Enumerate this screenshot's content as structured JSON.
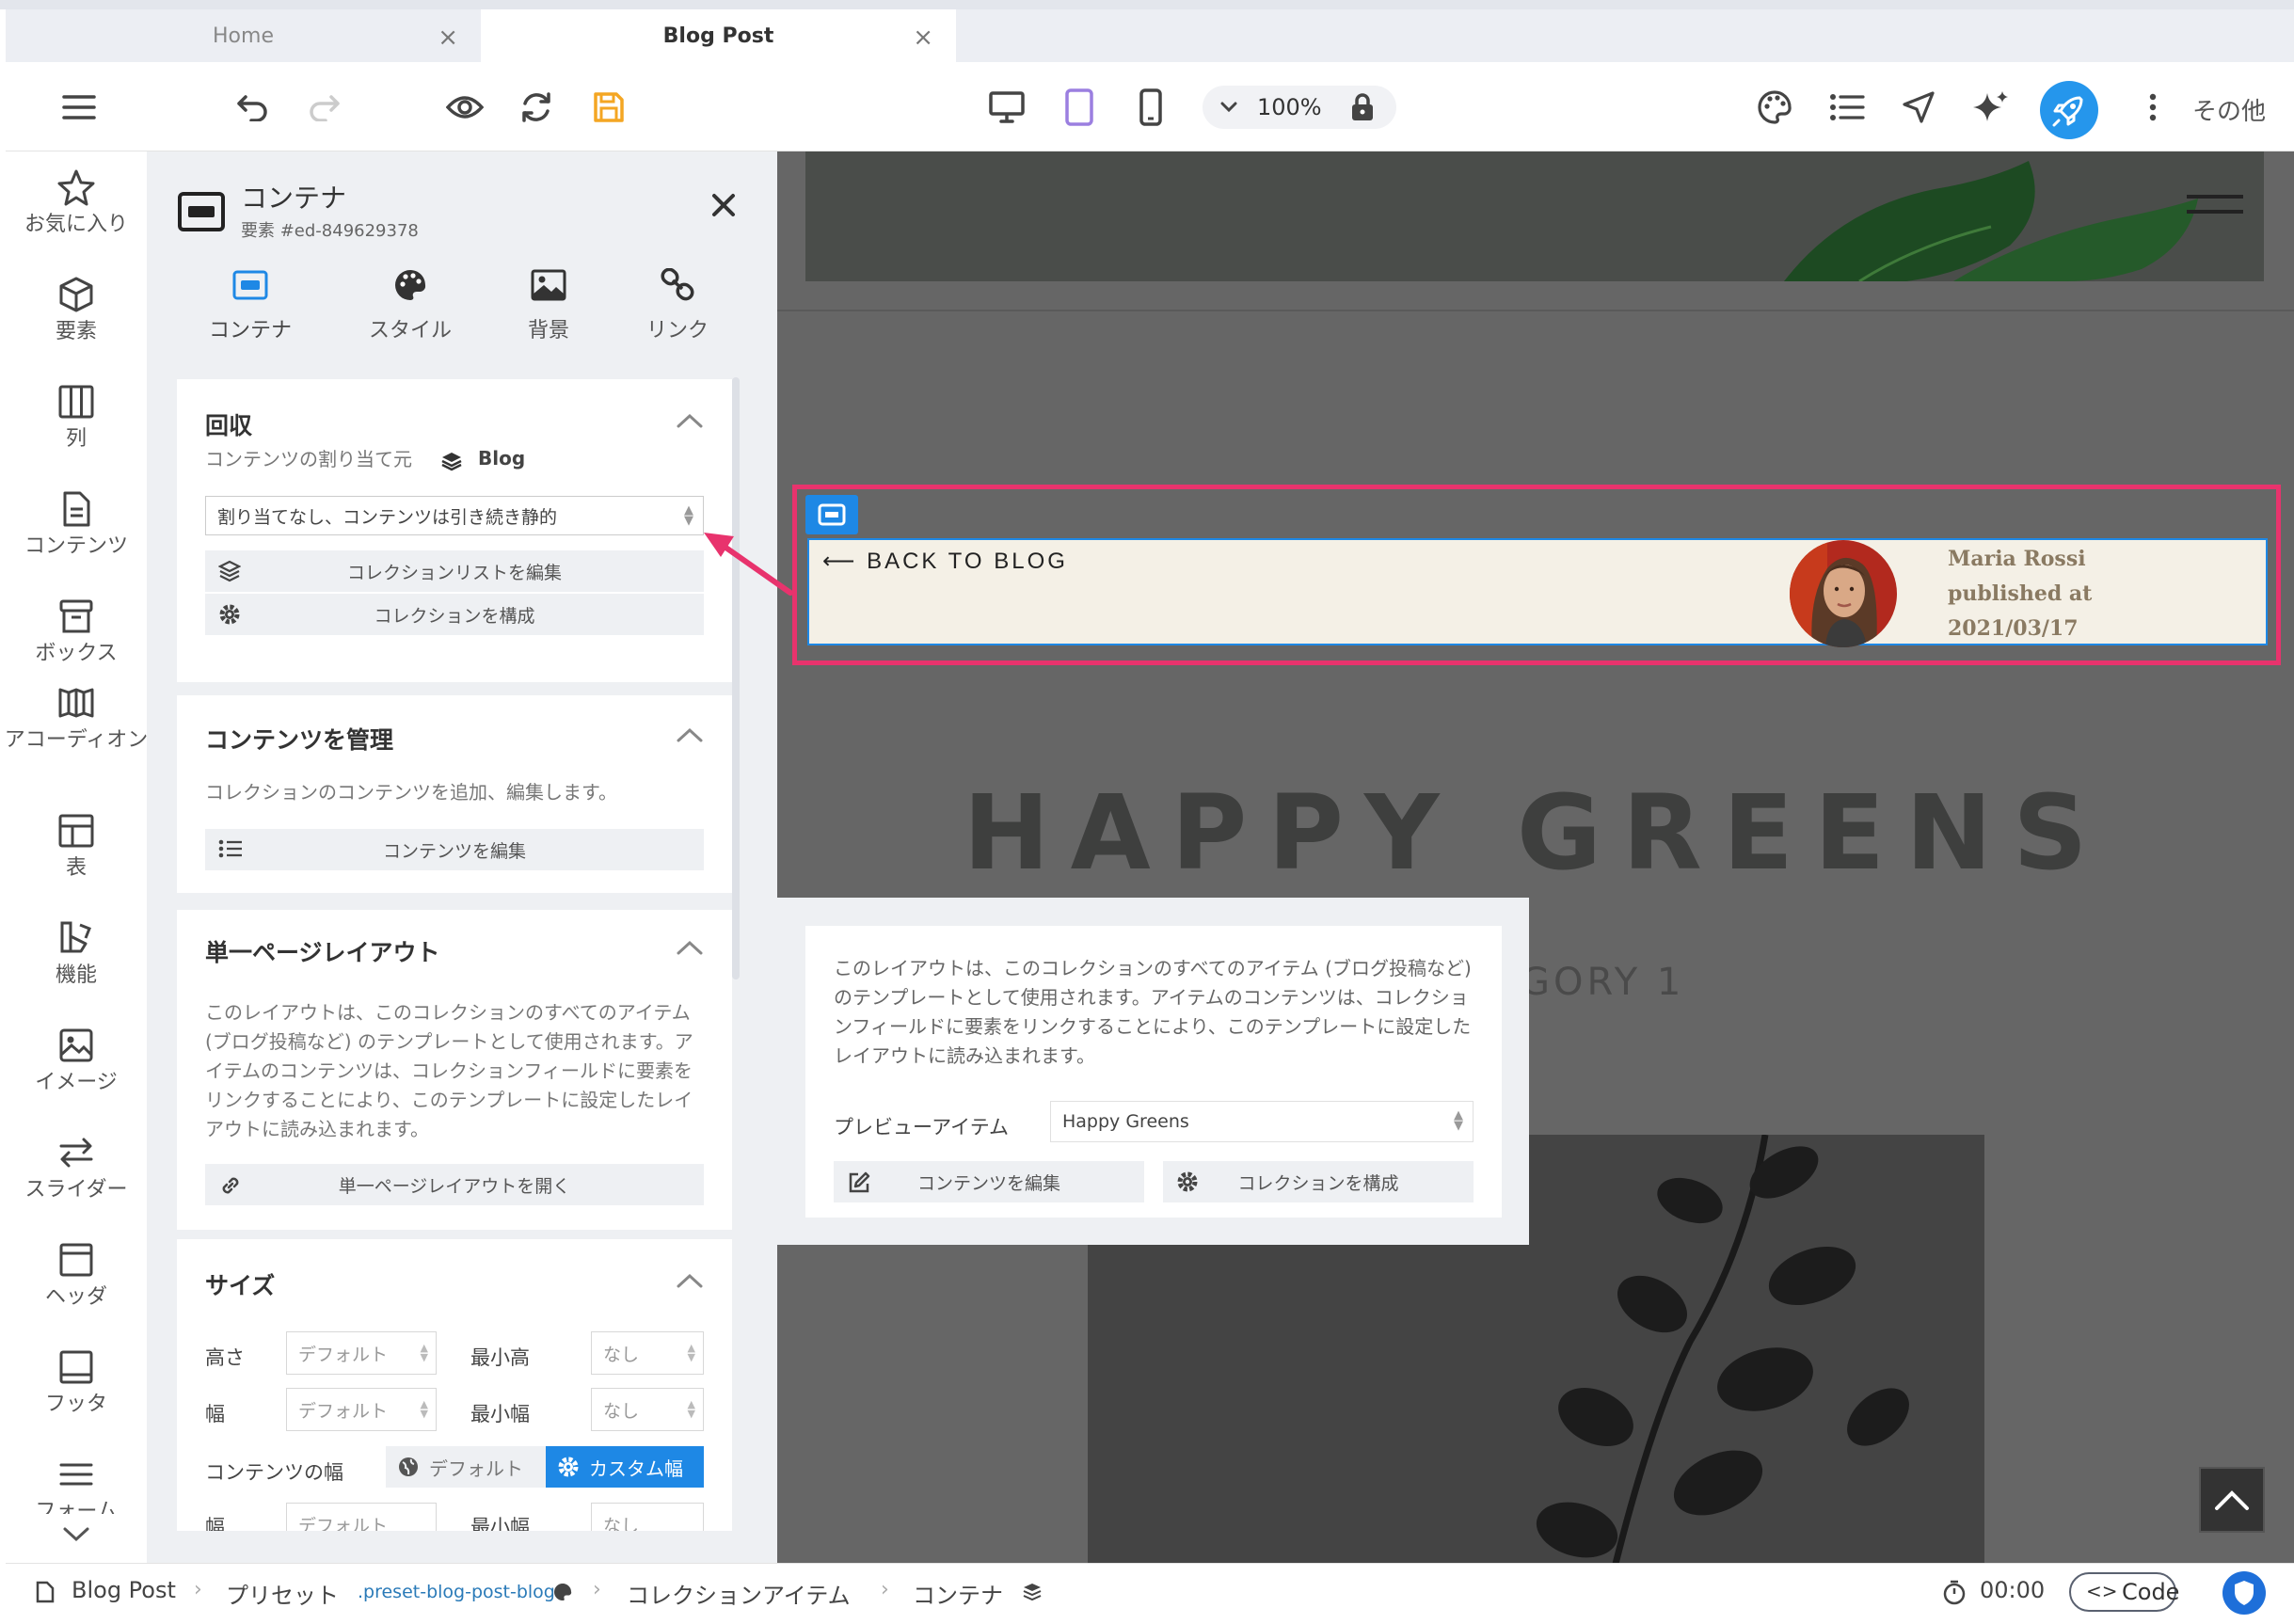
{
  "tabs": [
    {
      "label": "Home"
    },
    {
      "label": "Blog Post"
    }
  ],
  "toolbar": {
    "zoom": "100%",
    "more_label": "その他"
  },
  "rail": [
    {
      "label": "お気に入り"
    },
    {
      "label": "要素"
    },
    {
      "label": "列"
    },
    {
      "label": "コンテンツ"
    },
    {
      "label": "ボックス"
    },
    {
      "label": "アコーディオン"
    },
    {
      "label": "表"
    },
    {
      "label": "機能"
    },
    {
      "label": "イメージ"
    },
    {
      "label": "スライダー"
    },
    {
      "label": "ヘッダ"
    },
    {
      "label": "フッタ"
    },
    {
      "label": "フォーム"
    }
  ],
  "panel": {
    "title": "コンテナ",
    "subtitle": "要素 #ed-849629378",
    "tabs": [
      {
        "label": "コンテナ"
      },
      {
        "label": "スタイル"
      },
      {
        "label": "背景"
      },
      {
        "label": "リンク"
      }
    ],
    "collection": {
      "heading": "回収",
      "assign_label": "コンテンツの割り当て元",
      "assign_source": "Blog",
      "select_value": "割り当てなし、コンテンツは引き続き静的",
      "edit_list_btn": "コレクションリストを編集",
      "configure_btn": "コレクションを構成"
    },
    "manage": {
      "heading": "コンテンツを管理",
      "desc": "コレクションのコンテンツを追加、編集します。",
      "edit_btn": "コンテンツを編集"
    },
    "single": {
      "heading": "単一ページレイアウト",
      "desc": "このレイアウトは、このコレクションのすべてのアイテム (ブログ投稿など) のテンプレートとして使用されます。アイテムのコンテンツは、コレクションフィールドに要素をリンクすることにより、このテンプレートに設定したレイアウトに読み込まれます。",
      "open_btn": "単一ページレイアウトを開く"
    },
    "size": {
      "heading": "サイズ",
      "height_label": "高さ",
      "height_value": "デフォルト",
      "min_height_label": "最小高",
      "min_height_value": "なし",
      "width_label": "幅",
      "width_value": "デフォルト",
      "min_width_label": "最小幅",
      "min_width_value": "なし",
      "content_width_label": "コンテンツの幅",
      "default_opt": "デフォルト",
      "custom_opt": "カスタム幅",
      "width2_label": "幅",
      "width2_value": "デフォルト",
      "max_width_label": "最小幅",
      "max_width_value": "なし"
    }
  },
  "canvas": {
    "back_link": "BACK TO BLOG",
    "author_name": "Maria Rossi",
    "published_label": "published at",
    "published_date": "2021/03/17",
    "title": "HAPPY GREENS",
    "category": "GORY 1"
  },
  "popover": {
    "desc": "このレイアウトは、このコレクションのすべてのアイテム (ブログ投稿など) のテンプレートとして使用されます。アイテムのコンテンツは、コレクションフィールドに要素をリンクすることにより、このテンプレートに設定したレイアウトに読み込まれます。",
    "preview_label": "プレビューアイテム",
    "preview_value": "Happy Greens",
    "edit_btn": "コンテンツを編集",
    "configure_btn": "コレクションを構成"
  },
  "statusbar": {
    "page": "Blog Post",
    "preset": "プリセット",
    "preset_class": ".preset-blog-post-blog",
    "collection_item": "コレクションアイテム",
    "container": "コンテナ",
    "timer": "00:00",
    "code_label": "Code"
  },
  "colors": {
    "accent": "#1e88e5",
    "selection": "#e8336d",
    "save": "#f4a623",
    "rocket": "#2596ec"
  }
}
